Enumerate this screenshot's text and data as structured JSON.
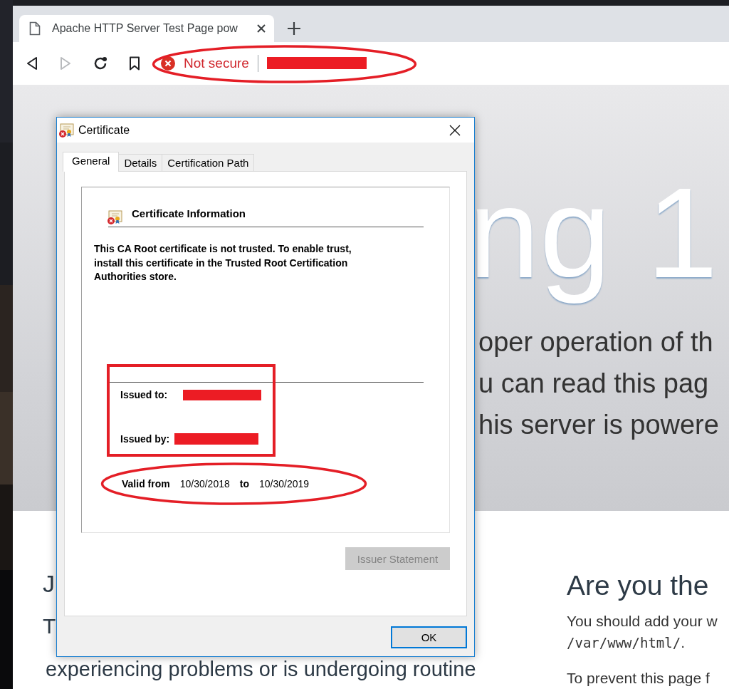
{
  "browser": {
    "tab": {
      "title": "Apache HTTP Server Test Page pow"
    },
    "nav": [
      {
        "kind": "back",
        "disabled": false
      },
      {
        "kind": "forward",
        "disabled": true
      },
      {
        "kind": "reload",
        "disabled": false
      },
      {
        "kind": "bookmark",
        "disabled": false
      }
    ],
    "omnibox": {
      "security": "Not secure"
    }
  },
  "page": {
    "banner": {
      "heading": "ng 1",
      "lines": [
        "oper operation of th",
        "u can read this pag",
        "his server is powere"
      ]
    },
    "left": {
      "heading": "J",
      "lines": [
        "T",
        "experiencing problems or is undergoing routine"
      ]
    },
    "right": {
      "heading": "Are you the",
      "paragraphs": [
        {
          "kind": "text",
          "text": "You should add your w"
        },
        {
          "kind": "code",
          "text": "/var/www/html/",
          "after": "."
        },
        {
          "kind": "text",
          "text": "To prevent this page f"
        }
      ]
    }
  },
  "dialog": {
    "title": "Certificate",
    "tabs": [
      {
        "label": "General",
        "selected": true
      },
      {
        "label": "Details",
        "selected": false
      },
      {
        "label": "Certification Path",
        "selected": false
      }
    ],
    "info_title": "Certificate Information",
    "message": "This CA Root certificate is not trusted. To enable trust, install this certificate in the Trusted Root Certification Authorities store.",
    "fields": [
      {
        "label": "Issued to:"
      },
      {
        "label": "Issued by:"
      }
    ],
    "validity": {
      "label": "Valid from",
      "from": "10/30/2018",
      "to_label": "to",
      "to": "10/30/2019"
    },
    "panel_button": {
      "label": "Issuer Statement",
      "disabled": true
    },
    "footer_button": {
      "label": "OK",
      "disabled": false,
      "default": true
    }
  }
}
